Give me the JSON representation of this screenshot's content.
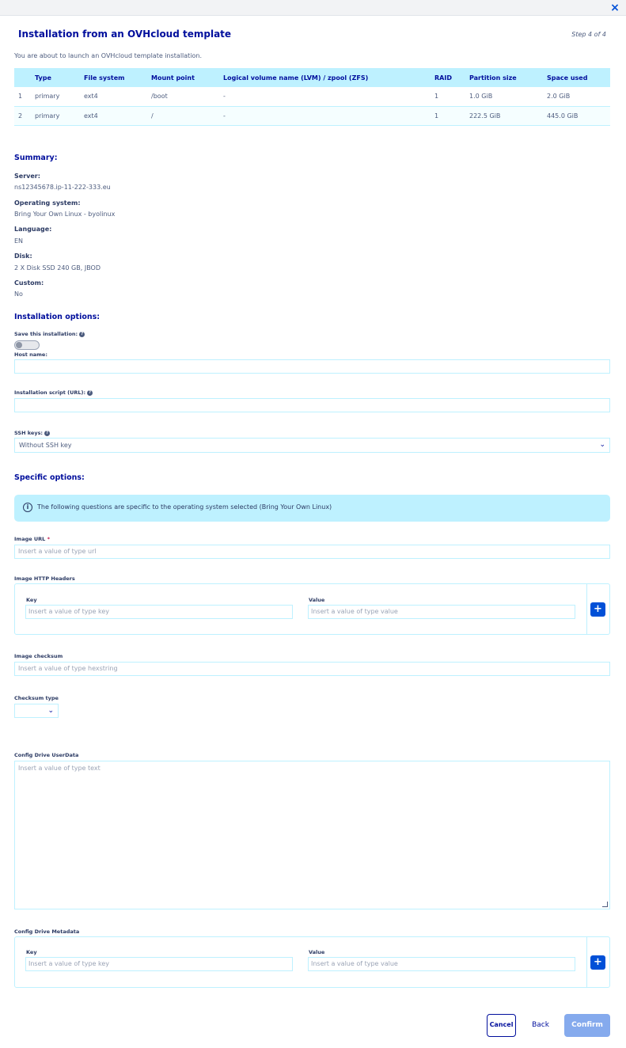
{
  "modal": {
    "close_label": "×",
    "title": "Installation from an OVHcloud template",
    "step": "Step 4 of 4",
    "intro": "You are about to launch an OVHcloud template installation."
  },
  "partitions": {
    "headers": [
      "",
      "Type",
      "File system",
      "Mount point",
      "Logical volume name (LVM) / zpool (ZFS)",
      "RAID",
      "Partition size",
      "Space used"
    ],
    "rows": [
      [
        "1",
        "primary",
        "ext4",
        "/boot",
        "-",
        "1",
        "1.0 GiB",
        "2.0 GiB"
      ],
      [
        "2",
        "primary",
        "ext4",
        "/",
        "-",
        "1",
        "222.5 GiB",
        "445.0 GiB"
      ]
    ]
  },
  "summary": {
    "heading": "Summary:",
    "server_label": "Server:",
    "server_value": "ns12345678.ip-11-222-333.eu",
    "os_label": "Operating system:",
    "os_value": "Bring Your Own Linux - byolinux",
    "language_label": "Language:",
    "language_value": "EN",
    "disk_label": "Disk:",
    "disk_value": "2 X Disk SSD 240 GB, JBOD",
    "custom_label": "Custom:",
    "custom_value": "No"
  },
  "install_options": {
    "heading": "Installation options:",
    "save_label": "Save this installation:",
    "save_enabled": false,
    "hostname_label": "Host name:",
    "hostname_value": "",
    "script_label": "Installation script (URL):",
    "script_value": "",
    "ssh_label": "SSH keys:",
    "ssh_selected": "Without SSH key"
  },
  "specific": {
    "heading": "Specific options:",
    "info_text": "The following questions are specific to the operating system selected (Bring Your Own Linux)",
    "image_url_label": "Image URL",
    "image_url_required": "*",
    "image_url_placeholder": "Insert a value of type url",
    "headers_label": "Image HTTP Headers",
    "headers_key_label": "Key",
    "headers_key_placeholder": "Insert a value of type key",
    "headers_value_label": "Value",
    "headers_value_placeholder": "Insert a value of type value",
    "checksum_label": "Image checksum",
    "checksum_placeholder": "Insert a value of type hexstring",
    "checksum_type_label": "Checksum type",
    "checksum_type_selected": "",
    "userdata_label": "Config Drive UserData",
    "userdata_placeholder": "Insert a value of type text",
    "metadata_label": "Config Drive Metadata",
    "metadata_key_label": "Key",
    "metadata_key_placeholder": "Insert a value of type key",
    "metadata_value_label": "Value",
    "metadata_value_placeholder": "Insert a value of type value",
    "add_label": "+"
  },
  "footer": {
    "cancel_label": "Cancel",
    "back_label": "Back",
    "confirm_label": "Confirm"
  },
  "colors": {
    "primary": "#000e9c",
    "accent": "#0050d7",
    "light_blue": "#bef1ff",
    "confirm_disabled": "#85aaed"
  }
}
